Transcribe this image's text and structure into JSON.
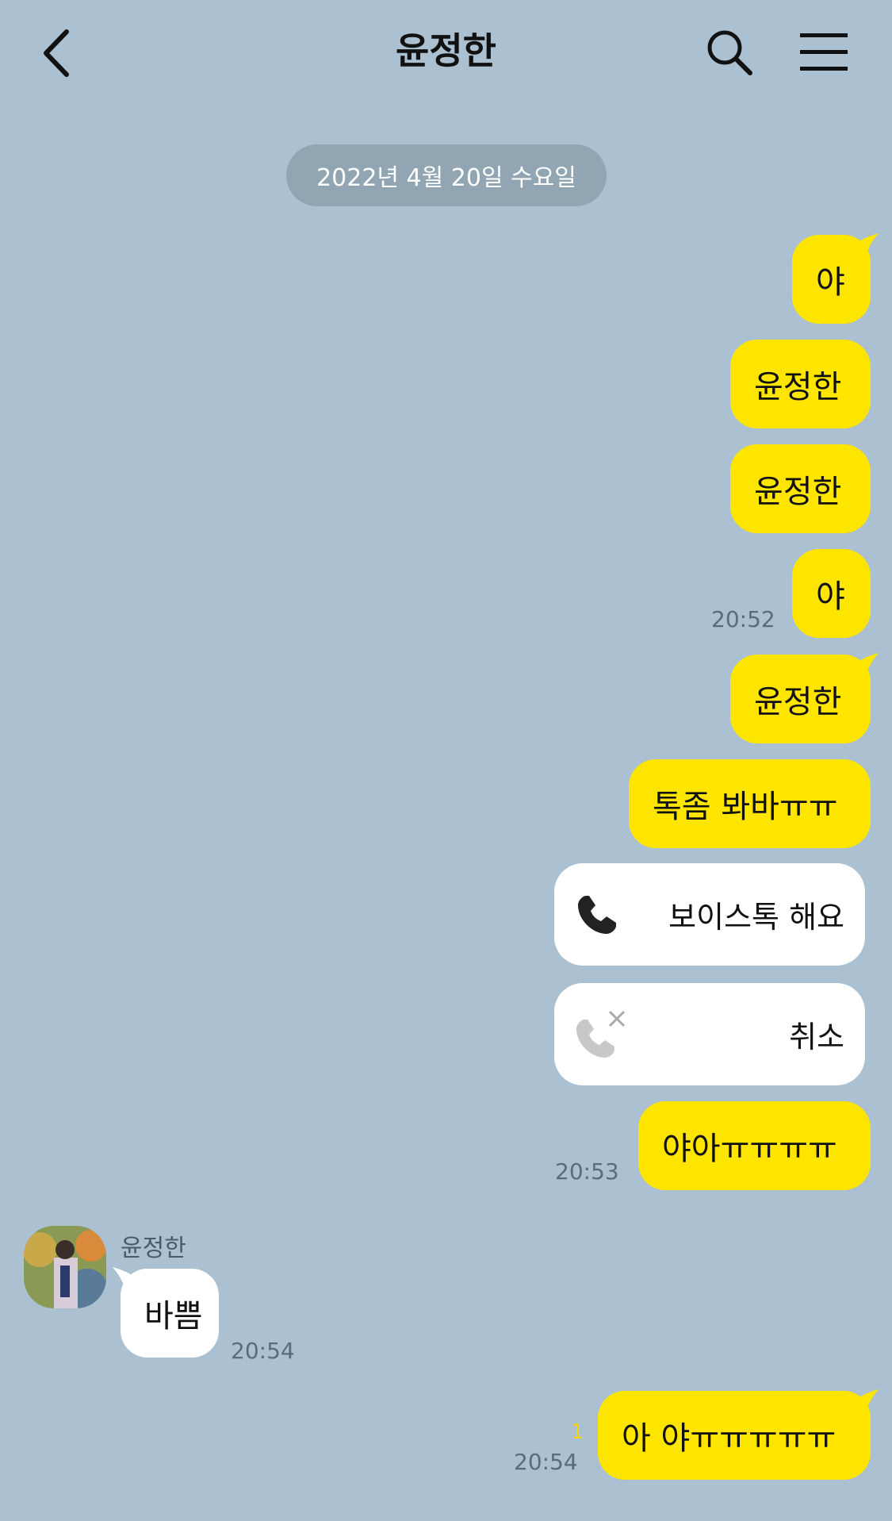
{
  "header": {
    "title": "윤정한",
    "back_icon": "chevron-left-icon",
    "search_icon": "search-icon",
    "menu_icon": "hamburger-menu-icon"
  },
  "date_divider": "2022년 4월 20일 수요일",
  "messages": [
    {
      "text": "야"
    },
    {
      "text": "윤정한"
    },
    {
      "text": "윤정한"
    },
    {
      "text": "야",
      "time": "20:52"
    },
    {
      "text": "윤정한"
    },
    {
      "text": "톡좀 봐바ㅠㅠ"
    },
    {
      "text": "보이스톡 해요",
      "icon": "phone-icon"
    },
    {
      "text": "취소",
      "icon": "phone-cancelled-icon"
    },
    {
      "text": "야아ㅠㅠㅠㅠ",
      "time": "20:53"
    }
  ],
  "incoming": {
    "sender": "윤정한",
    "text": "바쁨",
    "time": "20:54"
  },
  "last_message": {
    "text": "아 야ㅠㅠㅠㅠㅠ",
    "time": "20:54",
    "unread": "1"
  },
  "colors": {
    "background": "#abc1d1",
    "my_bubble": "#fee500",
    "other_bubble": "#ffffff"
  }
}
